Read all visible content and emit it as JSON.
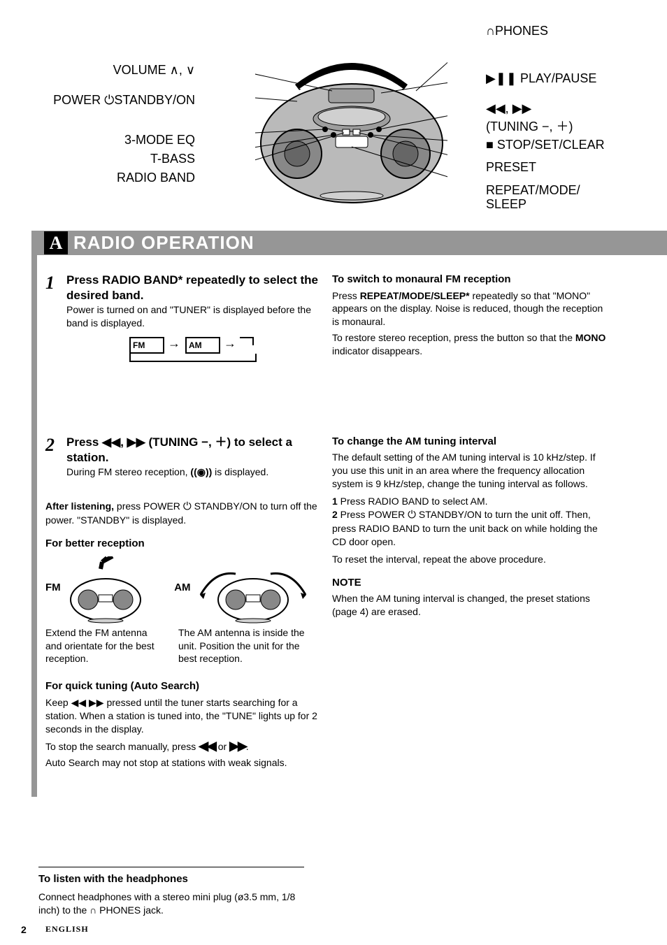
{
  "diagram": {
    "left_labels": {
      "volume": "VOLUME ∧, ∨",
      "power": "POWER ⏻STANDBY/ON",
      "eq": "3-MODE EQ",
      "tbass": "T-BASS",
      "radioband": "RADIO BAND"
    },
    "right_labels": {
      "phones": "∩PHONES",
      "play": "▶❚❚ PLAY/PAUSE",
      "tuning1": "◀◀, ▶▶",
      "tuning2": "(TUNING −, ＋)",
      "stop": "■ STOP/SET/CLEAR",
      "preset": "PRESET",
      "repeat1": "REPEAT/MODE/",
      "repeat2": "SLEEP"
    }
  },
  "section": {
    "letter": "A",
    "title": "RADIO OPERATION"
  },
  "left_col": {
    "step1_num": "1",
    "step1_bold": "Press RADIO BAND* repeatedly to select the desired band.",
    "step1_small": "Power is turned on and \"TUNER\" is displayed before the band is displayed.",
    "band_fm": "FM",
    "band_am": "AM",
    "step2_num": "2",
    "step2_bold_pre": "Press ",
    "step2_bold_mid": " (TUNING −, ＋) to select a station.",
    "step2_small_pre": "During FM stereo reception, ",
    "step2_small_icon": "((◉))",
    "step2_small_post": " is displayed.",
    "after_hdr": "After listening,",
    "after_body_pre": " press POWER ",
    "after_body_post": " STANDBY/ON to turn off the power. \"STANDBY\" is displayed.",
    "better_hdr": "For better reception",
    "fm_label": "FM",
    "am_label": "AM",
    "fm_caption": "Extend the FM antenna and orientate for the best reception.",
    "am_caption": "The AM antenna is inside the unit. Position the unit for the best reception.",
    "quick_hdr": "For quick tuning (Auto Search)",
    "quick_body_pre": "Keep ",
    "quick_body_mid": " pressed until the tuner starts searching for a station. When a station is tuned into, the \"TUNE\" lights up for 2 seconds in the display.",
    "quick_body2_pre": "To stop the search manually, press ",
    "quick_body2_post": ".",
    "quick_body3": "Auto Search may not stop at stations with weak signals."
  },
  "right_col": {
    "mono_hdr": "To switch to monaural FM reception",
    "mono_body_pre": "Press ",
    "mono_bold": "REPEAT/MODE/SLEEP*",
    "mono_body_post": " repeatedly so that \"MONO\" appears on the display. Noise is reduced, though the reception is monaural.",
    "mono_body2_pre": "To restore stereo reception, press the button so that the ",
    "mono_strong": "MONO",
    "mono_body2_post": " indicator disappears.",
    "am_hdr": "To change the AM tuning interval",
    "am_body1": "The default setting of the AM tuning interval is 10 kHz/step. If you use this unit in an area where the frequency allocation system is 9 kHz/step, change the tuning interval as follows.",
    "am_l1_num": "1",
    "am_l1": " Press RADIO BAND to select AM.",
    "am_l2_num": "2",
    "am_l2_pre": " Press POWER ",
    "am_l2_post": " STANDBY/ON to turn the unit off. Then, press RADIO BAND to turn the unit back on while holding the CD door open.",
    "am_body2": "To reset the interval, repeat the above procedure.",
    "note_hdr": "NOTE",
    "note_body": "When the AM tuning interval is changed, the preset stations (page 4) are erased."
  },
  "foot": {
    "hdr": "To listen with the headphones",
    "body_pre": "Connect headphones with a stereo mini plug (ø3.5 mm, 1/8 inch) to the ",
    "body_icon": "∩",
    "body_post": " PHONES jack."
  },
  "footer": {
    "pagenum": "2",
    "lang": "ENGLISH"
  }
}
